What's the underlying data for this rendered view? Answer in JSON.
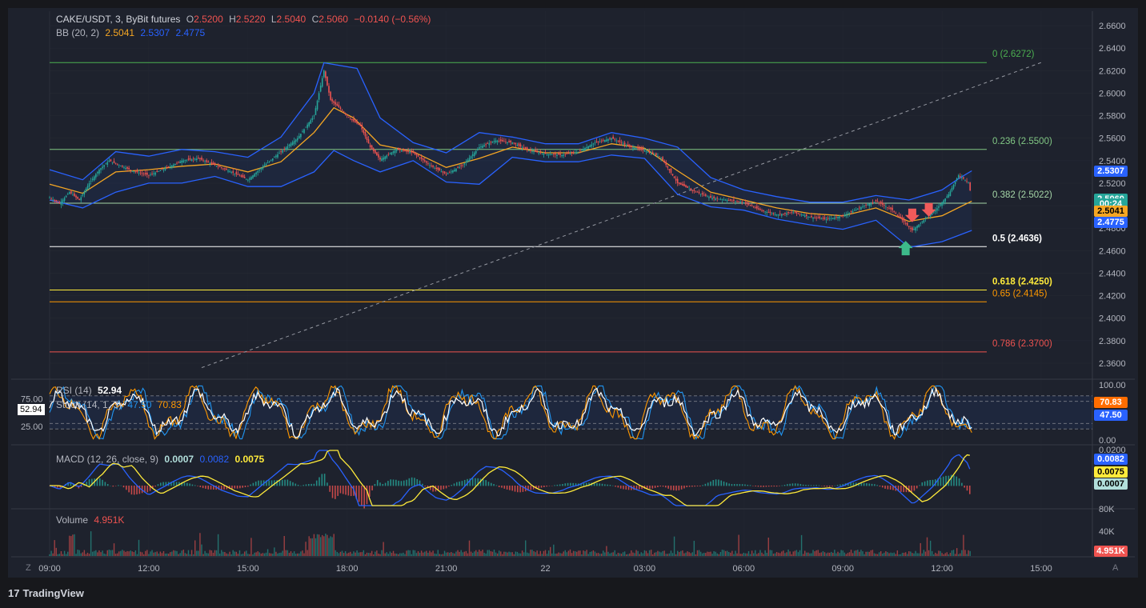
{
  "header": {
    "symbol": "CAKE/USDT, 3, ByBit futures",
    "ohlc": [
      {
        "k": "O",
        "v": "2.5200"
      },
      {
        "k": "H",
        "v": "2.5220"
      },
      {
        "k": "L",
        "v": "2.5040"
      },
      {
        "k": "C",
        "v": "2.5060"
      }
    ],
    "change": "−0.0140 (−0.56%)"
  },
  "bb_legend": {
    "label": "BB (20, 2)",
    "basis": "2.5041",
    "upper": "2.5307",
    "lower": "2.4775"
  },
  "rsi_legend": {
    "label": "RSI (14)",
    "value": "52.94"
  },
  "stoch_legend": {
    "label": "Stoch (14, 1, 3)",
    "k": "47.50",
    "d": "70.83"
  },
  "macd_legend": {
    "label": "MACD (12, 26, close, 9)",
    "hist": "0.0007",
    "macd": "0.0082",
    "signal": "0.0075"
  },
  "volume_legend": {
    "label": "Volume",
    "value": "4.951K"
  },
  "colors": {
    "bg": "#1e222d",
    "grid": "#2a2e39",
    "up": "#26a69a",
    "down": "#ef5350",
    "bb_basis": "#f5a623",
    "bb_band": "#2962ff",
    "rsi": "#ffffff",
    "stoch_k": "#2196f3",
    "stoch_d": "#ff9800",
    "macd": "#2962ff",
    "signal": "#ffeb3b"
  },
  "chart_data": {
    "type": "line",
    "x_tick_labels": [
      "09:00",
      "12:00",
      "15:00",
      "18:00",
      "21:00",
      "22",
      "03:00",
      "06:00",
      "09:00",
      "12:00",
      "15:00"
    ],
    "price_axis": {
      "ylim": [
        2.35,
        2.67
      ],
      "ticks": [
        "2.6600",
        "2.6400",
        "2.6200",
        "2.6000",
        "2.5800",
        "2.5600",
        "2.5400",
        "2.5200",
        "2.5000",
        "2.4800",
        "2.4600",
        "2.4400",
        "2.4200",
        "2.4000",
        "2.3800",
        "2.3600"
      ]
    },
    "fib_levels": [
      {
        "ratio": "0",
        "price": 2.6272,
        "label": "0 (2.6272)",
        "color": "#4caf50"
      },
      {
        "ratio": "0.236",
        "price": 2.55,
        "label": "0.236 (2.5500)",
        "color": "#81c784"
      },
      {
        "ratio": "0.382",
        "price": 2.5022,
        "label": "0.382 (2.5022)",
        "color": "#a5d6a7"
      },
      {
        "ratio": "0.5",
        "price": 2.4636,
        "label": "0.5 (2.4636)",
        "color": "#ffffff"
      },
      {
        "ratio": "0.618",
        "price": 2.425,
        "label": "0.618 (2.4250)",
        "color": "#ffeb3b"
      },
      {
        "ratio": "0.65",
        "price": 2.4145,
        "label": "0.65 (2.4145)",
        "color": "#ff9800"
      },
      {
        "ratio": "0.786",
        "price": 2.37,
        "label": "0.786 (2.3700)",
        "color": "#ef5350"
      }
    ],
    "price_series": [
      {
        "x": 0,
        "v": 2.507
      },
      {
        "x": 0.3,
        "v": 2.502
      },
      {
        "x": 0.6,
        "v": 2.512
      },
      {
        "x": 0.9,
        "v": 2.505
      },
      {
        "x": 1.2,
        "v": 2.52
      },
      {
        "x": 1.5,
        "v": 2.532
      },
      {
        "x": 1.8,
        "v": 2.54
      },
      {
        "x": 2.1,
        "v": 2.536
      },
      {
        "x": 2.5,
        "v": 2.531
      },
      {
        "x": 3.0,
        "v": 2.527
      },
      {
        "x": 3.5,
        "v": 2.533
      },
      {
        "x": 4.0,
        "v": 2.54
      },
      {
        "x": 4.5,
        "v": 2.542
      },
      {
        "x": 5.0,
        "v": 2.536
      },
      {
        "x": 5.5,
        "v": 2.53
      },
      {
        "x": 6.0,
        "v": 2.523
      },
      {
        "x": 6.5,
        "v": 2.536
      },
      {
        "x": 7.0,
        "v": 2.548
      },
      {
        "x": 7.5,
        "v": 2.56
      },
      {
        "x": 8.0,
        "v": 2.58
      },
      {
        "x": 8.3,
        "v": 2.62
      },
      {
        "x": 8.5,
        "v": 2.594
      },
      {
        "x": 8.8,
        "v": 2.586
      },
      {
        "x": 9.1,
        "v": 2.577
      },
      {
        "x": 9.4,
        "v": 2.571
      },
      {
        "x": 9.7,
        "v": 2.552
      },
      {
        "x": 10.0,
        "v": 2.541
      },
      {
        "x": 10.5,
        "v": 2.55
      },
      {
        "x": 11.0,
        "v": 2.547
      },
      {
        "x": 11.5,
        "v": 2.536
      },
      {
        "x": 12.0,
        "v": 2.528
      },
      {
        "x": 12.5,
        "v": 2.536
      },
      {
        "x": 13.0,
        "v": 2.552
      },
      {
        "x": 13.5,
        "v": 2.558
      },
      {
        "x": 14.0,
        "v": 2.556
      },
      {
        "x": 14.5,
        "v": 2.549
      },
      {
        "x": 15.0,
        "v": 2.546
      },
      {
        "x": 15.5,
        "v": 2.545
      },
      {
        "x": 16.0,
        "v": 2.548
      },
      {
        "x": 16.5,
        "v": 2.556
      },
      {
        "x": 17.0,
        "v": 2.56
      },
      {
        "x": 17.5,
        "v": 2.553
      },
      {
        "x": 18.0,
        "v": 2.549
      },
      {
        "x": 18.5,
        "v": 2.543
      },
      {
        "x": 19.0,
        "v": 2.52
      },
      {
        "x": 19.5,
        "v": 2.513
      },
      {
        "x": 20.0,
        "v": 2.507
      },
      {
        "x": 20.5,
        "v": 2.505
      },
      {
        "x": 21.0,
        "v": 2.503
      },
      {
        "x": 21.5,
        "v": 2.496
      },
      {
        "x": 22.0,
        "v": 2.492
      },
      {
        "x": 22.5,
        "v": 2.494
      },
      {
        "x": 23.0,
        "v": 2.49
      },
      {
        "x": 23.5,
        "v": 2.488
      },
      {
        "x": 24.0,
        "v": 2.491
      },
      {
        "x": 24.5,
        "v": 2.498
      },
      {
        "x": 25.0,
        "v": 2.504
      },
      {
        "x": 25.5,
        "v": 2.496
      },
      {
        "x": 25.8,
        "v": 2.487
      },
      {
        "x": 26.1,
        "v": 2.478
      },
      {
        "x": 26.4,
        "v": 2.486
      },
      {
        "x": 26.8,
        "v": 2.496
      },
      {
        "x": 27.2,
        "v": 2.51
      },
      {
        "x": 27.5,
        "v": 2.527
      },
      {
        "x": 27.8,
        "v": 2.521
      },
      {
        "x": 27.9,
        "v": 2.506
      }
    ],
    "bb_basis": [
      {
        "x": 0,
        "v": 2.519
      },
      {
        "x": 1.0,
        "v": 2.511
      },
      {
        "x": 2.0,
        "v": 2.53
      },
      {
        "x": 3.0,
        "v": 2.532
      },
      {
        "x": 4.0,
        "v": 2.535
      },
      {
        "x": 5.0,
        "v": 2.537
      },
      {
        "x": 6.0,
        "v": 2.53
      },
      {
        "x": 7.0,
        "v": 2.539
      },
      {
        "x": 8.0,
        "v": 2.565
      },
      {
        "x": 8.6,
        "v": 2.587
      },
      {
        "x": 9.2,
        "v": 2.578
      },
      {
        "x": 10.0,
        "v": 2.554
      },
      {
        "x": 11.0,
        "v": 2.548
      },
      {
        "x": 12.0,
        "v": 2.534
      },
      {
        "x": 13.0,
        "v": 2.542
      },
      {
        "x": 14.0,
        "v": 2.552
      },
      {
        "x": 15.0,
        "v": 2.547
      },
      {
        "x": 16.0,
        "v": 2.547
      },
      {
        "x": 17.0,
        "v": 2.555
      },
      {
        "x": 18.0,
        "v": 2.551
      },
      {
        "x": 19.0,
        "v": 2.531
      },
      {
        "x": 20.0,
        "v": 2.512
      },
      {
        "x": 21.0,
        "v": 2.505
      },
      {
        "x": 22.0,
        "v": 2.498
      },
      {
        "x": 23.0,
        "v": 2.493
      },
      {
        "x": 24.0,
        "v": 2.491
      },
      {
        "x": 25.0,
        "v": 2.498
      },
      {
        "x": 26.0,
        "v": 2.486
      },
      {
        "x": 27.0,
        "v": 2.491
      },
      {
        "x": 27.9,
        "v": 2.504
      }
    ],
    "bb_upper": [
      {
        "x": 0,
        "v": 2.532
      },
      {
        "x": 1.0,
        "v": 2.523
      },
      {
        "x": 2.0,
        "v": 2.548
      },
      {
        "x": 3.0,
        "v": 2.544
      },
      {
        "x": 4.0,
        "v": 2.55
      },
      {
        "x": 5.0,
        "v": 2.548
      },
      {
        "x": 6.0,
        "v": 2.543
      },
      {
        "x": 7.0,
        "v": 2.561
      },
      {
        "x": 8.0,
        "v": 2.6
      },
      {
        "x": 8.3,
        "v": 2.627
      },
      {
        "x": 9.3,
        "v": 2.622
      },
      {
        "x": 10.0,
        "v": 2.578
      },
      {
        "x": 11.0,
        "v": 2.556
      },
      {
        "x": 12.0,
        "v": 2.547
      },
      {
        "x": 13.0,
        "v": 2.565
      },
      {
        "x": 14.0,
        "v": 2.561
      },
      {
        "x": 15.0,
        "v": 2.555
      },
      {
        "x": 16.0,
        "v": 2.555
      },
      {
        "x": 17.0,
        "v": 2.565
      },
      {
        "x": 18.0,
        "v": 2.56
      },
      {
        "x": 19.0,
        "v": 2.552
      },
      {
        "x": 20.0,
        "v": 2.525
      },
      {
        "x": 21.0,
        "v": 2.514
      },
      {
        "x": 22.0,
        "v": 2.508
      },
      {
        "x": 23.0,
        "v": 2.503
      },
      {
        "x": 24.0,
        "v": 2.503
      },
      {
        "x": 25.0,
        "v": 2.509
      },
      {
        "x": 26.0,
        "v": 2.505
      },
      {
        "x": 27.0,
        "v": 2.514
      },
      {
        "x": 27.5,
        "v": 2.524
      },
      {
        "x": 27.9,
        "v": 2.531
      }
    ],
    "bb_lower": [
      {
        "x": 0,
        "v": 2.505
      },
      {
        "x": 1.0,
        "v": 2.498
      },
      {
        "x": 2.0,
        "v": 2.512
      },
      {
        "x": 3.0,
        "v": 2.52
      },
      {
        "x": 4.0,
        "v": 2.52
      },
      {
        "x": 5.0,
        "v": 2.526
      },
      {
        "x": 6.0,
        "v": 2.517
      },
      {
        "x": 7.0,
        "v": 2.517
      },
      {
        "x": 8.0,
        "v": 2.53
      },
      {
        "x": 8.6,
        "v": 2.549
      },
      {
        "x": 9.2,
        "v": 2.54
      },
      {
        "x": 10.0,
        "v": 2.53
      },
      {
        "x": 11.0,
        "v": 2.54
      },
      {
        "x": 12.0,
        "v": 2.521
      },
      {
        "x": 13.0,
        "v": 2.519
      },
      {
        "x": 14.0,
        "v": 2.543
      },
      {
        "x": 15.0,
        "v": 2.539
      },
      {
        "x": 16.0,
        "v": 2.539
      },
      {
        "x": 17.0,
        "v": 2.545
      },
      {
        "x": 18.0,
        "v": 2.542
      },
      {
        "x": 19.0,
        "v": 2.51
      },
      {
        "x": 20.0,
        "v": 2.499
      },
      {
        "x": 21.0,
        "v": 2.496
      },
      {
        "x": 22.0,
        "v": 2.488
      },
      {
        "x": 23.0,
        "v": 2.483
      },
      {
        "x": 24.0,
        "v": 2.479
      },
      {
        "x": 25.0,
        "v": 2.487
      },
      {
        "x": 26.0,
        "v": 2.463
      },
      {
        "x": 27.0,
        "v": 2.468
      },
      {
        "x": 27.9,
        "v": 2.478
      }
    ],
    "diagonal_from": {
      "x": 4.6,
      "v": 2.356
    },
    "diagonal_to": {
      "x": 30.0,
      "v": 2.6272
    },
    "markers": [
      {
        "type": "sell",
        "x": 26.1,
        "v": 2.486
      },
      {
        "type": "sell",
        "x": 26.6,
        "v": 2.491
      },
      {
        "type": "buy",
        "x": 25.9,
        "v": 2.463
      }
    ],
    "rsi": {
      "ylim": [
        0,
        100
      ],
      "ticks": [
        "75.00",
        "25.00"
      ],
      "right_ticks": [
        "100.00",
        "0.00"
      ],
      "bands": [
        80,
        70,
        30,
        20
      ]
    },
    "stoch": {
      "k": 47.5,
      "d": 70.83
    },
    "macd_axis": {
      "ticks": [
        "0.0200"
      ]
    },
    "volume_axis": {
      "ticks": [
        "80K",
        "40K"
      ]
    },
    "series_count": 28
  },
  "price_tags": [
    {
      "label": "2.5307",
      "price": 2.5307,
      "bg": "#2962ff",
      "fg": "#ffffff"
    },
    {
      "label": "2.5060",
      "price": 2.506,
      "bg": "#26a69a",
      "fg": "#ffffff"
    },
    {
      "label": "00:24",
      "price": 2.5015,
      "bg": "#26a69a",
      "fg": "#ffffff"
    },
    {
      "label": "2.5041",
      "price": 2.495,
      "bg": "#f5a623",
      "fg": "#000000"
    },
    {
      "label": "2.4775",
      "price": 2.4852,
      "bg": "#2962ff",
      "fg": "#ffffff"
    }
  ],
  "indicator_tags": [
    {
      "label": "70.83",
      "y": 503,
      "bg": "#ff6d00",
      "fg": "#ffffff"
    },
    {
      "label": "47.50",
      "y": 519,
      "bg": "#2962ff",
      "fg": "#ffffff"
    },
    {
      "label": "0.0082",
      "y": 574,
      "bg": "#2962ff",
      "fg": "#ffffff"
    },
    {
      "label": "0.0075",
      "y": 590,
      "bg": "#ffeb3b",
      "fg": "#000000"
    },
    {
      "label": "0.0007",
      "y": 605,
      "bg": "#b2dfdb",
      "fg": "#000000"
    },
    {
      "label": "4.951K",
      "y": 689,
      "bg": "#ef5350",
      "fg": "#ffffff"
    }
  ],
  "rsi_left_tag": "52.94",
  "footer": {
    "brand": "TradingView",
    "logo": "17"
  },
  "corner_left": "Z",
  "corner_right": "A"
}
